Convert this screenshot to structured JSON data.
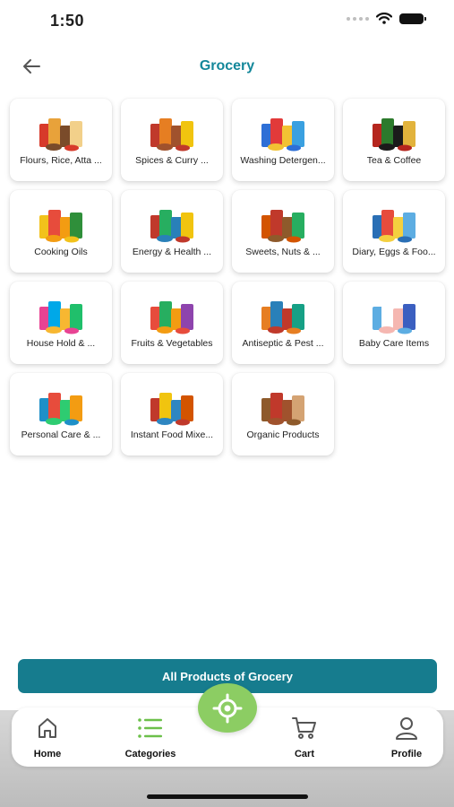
{
  "status_bar": {
    "time": "1:50"
  },
  "header": {
    "title": "Grocery"
  },
  "categories": [
    {
      "label": "Flours, Rice, Atta ...",
      "palette": [
        "#d73a2a",
        "#e8a23a",
        "#7a4b2a",
        "#f2d08a"
      ]
    },
    {
      "label": "Spices & Curry ...",
      "palette": [
        "#c0392b",
        "#e67e22",
        "#a0522d",
        "#f1c40f"
      ]
    },
    {
      "label": "Washing Detergen...",
      "palette": [
        "#2e6fd6",
        "#e23a3a",
        "#f2c233",
        "#3aa0e0"
      ]
    },
    {
      "label": "Tea & Coffee",
      "palette": [
        "#b5261e",
        "#2c7a2c",
        "#1b1b1b",
        "#e2b33c"
      ]
    },
    {
      "label": "Cooking Oils",
      "palette": [
        "#f2c21b",
        "#e74c3c",
        "#f39c12",
        "#2f8f3a"
      ]
    },
    {
      "label": "Energy & Health ...",
      "palette": [
        "#c0392b",
        "#27ae60",
        "#2980b9",
        "#f1c40f"
      ]
    },
    {
      "label": "Sweets, Nuts & ...",
      "palette": [
        "#d35400",
        "#c0392b",
        "#8e5a2b",
        "#27ae60"
      ]
    },
    {
      "label": "Diary, Eggs & Foo...",
      "palette": [
        "#2a6fb5",
        "#e74c3c",
        "#f4d03f",
        "#5dade2"
      ]
    },
    {
      "label": "House Hold & ...",
      "palette": [
        "#e84393",
        "#00a8e8",
        "#f7b731",
        "#20bf6b"
      ]
    },
    {
      "label": "Fruits & Vegetables",
      "palette": [
        "#e74c3c",
        "#27ae60",
        "#f39c12",
        "#8e44ad"
      ]
    },
    {
      "label": "Antiseptic & Pest ...",
      "palette": [
        "#e67e22",
        "#2980b9",
        "#c0392b",
        "#16a085"
      ]
    },
    {
      "label": "Baby Care Items",
      "palette": [
        "#5dade2",
        "#ffffff",
        "#f5b7b1",
        "#3b5fc0"
      ]
    },
    {
      "label": "Personal Care & ...",
      "palette": [
        "#1e90c8",
        "#e74c3c",
        "#2ecc71",
        "#f39c12"
      ]
    },
    {
      "label": "Instant Food Mixe...",
      "palette": [
        "#c0392b",
        "#f1c40f",
        "#2e86c1",
        "#d35400"
      ]
    },
    {
      "label": "Organic Products",
      "palette": [
        "#8e5a2b",
        "#c0392b",
        "#a0522d",
        "#d4a373"
      ]
    }
  ],
  "all_products_button": {
    "label": "All Products of Grocery"
  },
  "bottom_nav": {
    "items": [
      {
        "label": "Home",
        "icon": "home-icon"
      },
      {
        "label": "Categories",
        "icon": "list-icon"
      },
      {
        "label": "Cart",
        "icon": "cart-icon"
      },
      {
        "label": "Profile",
        "icon": "profile-icon"
      }
    ],
    "center_button_icon": "location-target-icon"
  },
  "colors": {
    "accent": "#13879a",
    "button": "#167c8e",
    "fab": "#8ccd63",
    "categories_icon": "#6cc04a"
  }
}
